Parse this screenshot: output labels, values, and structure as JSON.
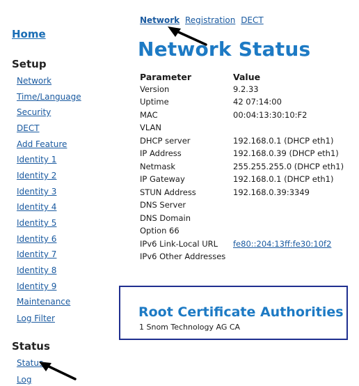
{
  "sidebar": {
    "home": "Home",
    "setup_title": "Setup",
    "setup_items": [
      "Network",
      "Time/Language",
      "Security",
      "DECT",
      "Add Feature",
      "Identity 1",
      "Identity 2",
      "Identity 3",
      "Identity 4",
      "Identity 5",
      "Identity 6",
      "Identity 7",
      "Identity 8",
      "Identity 9",
      "Maintenance",
      "Log Filter"
    ],
    "status_title": "Status",
    "status_items": [
      "Status",
      "Log"
    ]
  },
  "tabs": [
    "Network",
    "Registration",
    "DECT"
  ],
  "page_title": "Network Status",
  "table": {
    "header_param": "Parameter",
    "header_value": "Value",
    "rows": [
      {
        "k": "Version",
        "v": "9.2.33"
      },
      {
        "k": "Uptime",
        "v": "42 07:14:00"
      },
      {
        "k": "MAC",
        "v": "00:04:13:30:10:F2"
      },
      {
        "k": "VLAN",
        "v": ""
      },
      {
        "k": "DHCP server",
        "v": "192.168.0.1 (DHCP eth1)"
      },
      {
        "k": "IP Address",
        "v": "192.168.0.39 (DHCP eth1)"
      },
      {
        "k": "Netmask",
        "v": "255.255.255.0 (DHCP eth1)"
      },
      {
        "k": "IP Gateway",
        "v": "192.168.0.1 (DHCP eth1)"
      },
      {
        "k": "STUN Address",
        "v": "192.168.0.39:3349"
      },
      {
        "k": "DNS Server",
        "v": ""
      },
      {
        "k": "DNS Domain",
        "v": ""
      },
      {
        "k": "Option 66",
        "v": ""
      },
      {
        "k": "IPv6 Link-Local URL",
        "v": "fe80::204:13ff:fe30:10f2"
      },
      {
        "k": "IPv6 Other Addresses",
        "v": ""
      }
    ]
  },
  "root_ca": {
    "title": "Root Certificate Authorities",
    "items": [
      "1 Snom Technology AG CA"
    ]
  }
}
